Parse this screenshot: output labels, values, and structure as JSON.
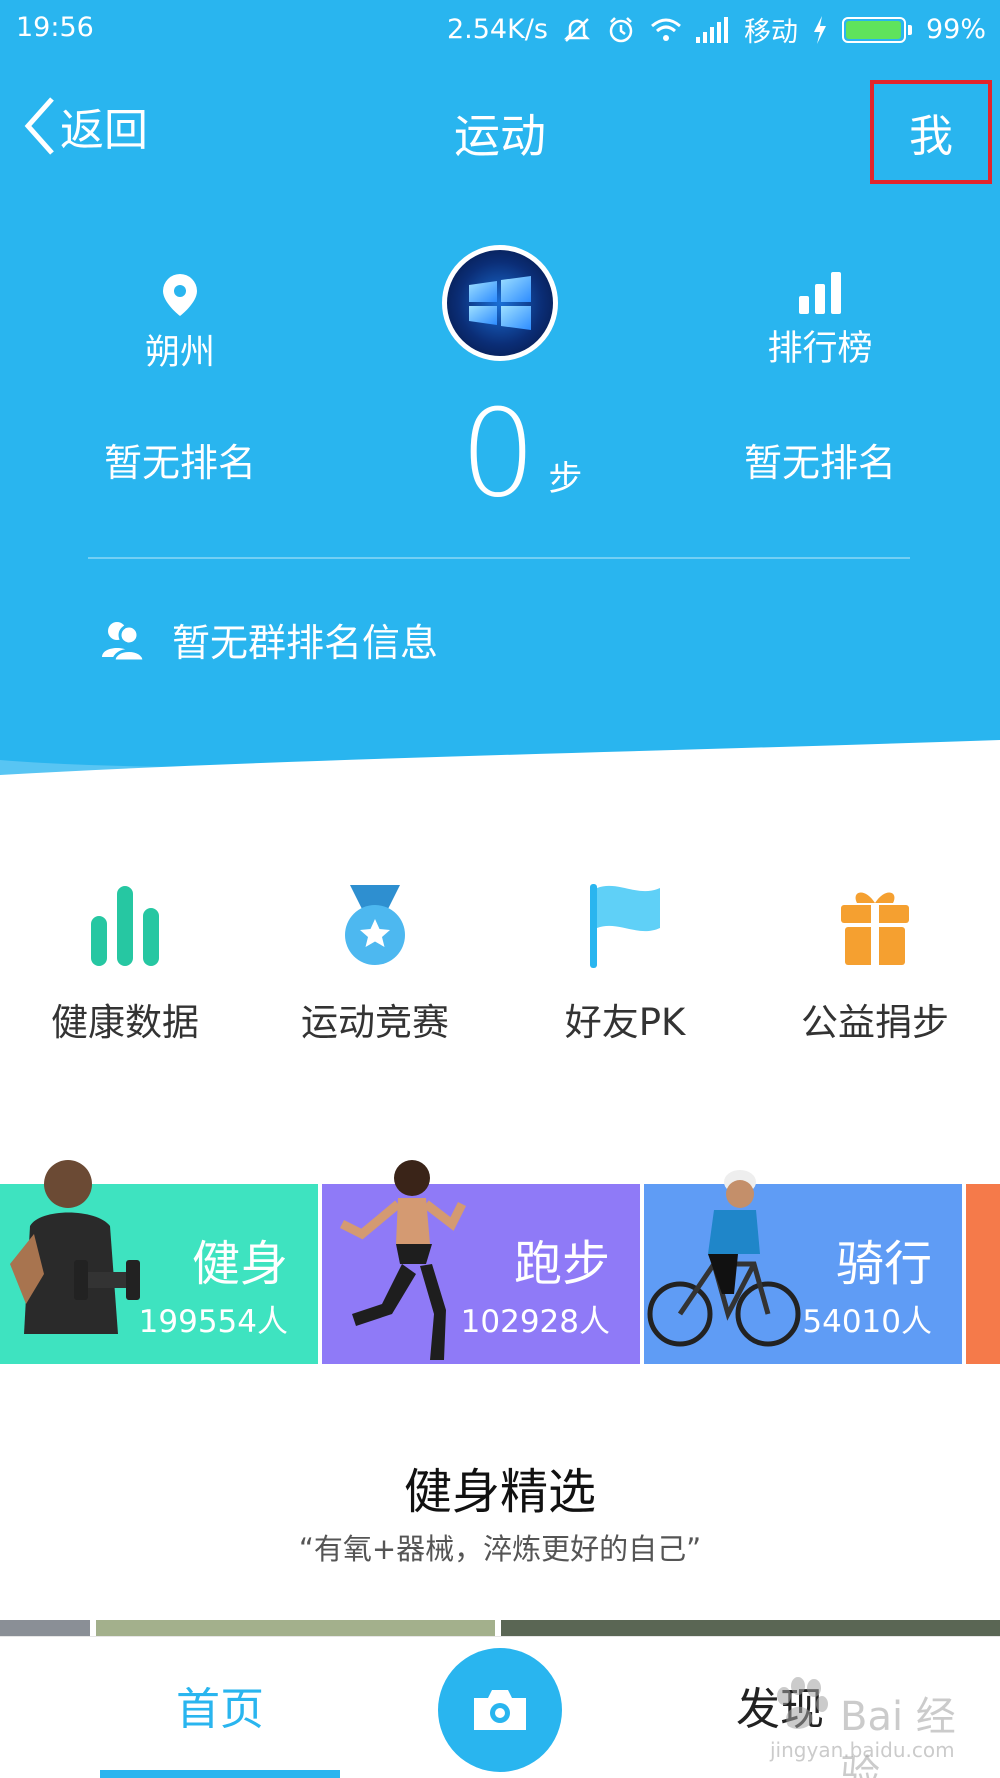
{
  "status_bar": {
    "time": "19:56",
    "net_speed": "2.54K/s",
    "carrier": "移动",
    "battery": "99%",
    "battery_level": 0.99,
    "icons": [
      "mute-icon",
      "alarm-icon",
      "wifi-icon",
      "signal-icon",
      "charging-icon"
    ]
  },
  "nav": {
    "back_label": "返回",
    "title": "运动",
    "me_label": "我"
  },
  "summary": {
    "city": "朔州",
    "leaderboard_label": "排行榜",
    "city_rank": "暂无排名",
    "steps": "0",
    "steps_unit": "步",
    "friend_rank": "暂无排名",
    "group_rank": "暂无群排名信息"
  },
  "functions": [
    {
      "label": "健康数据",
      "icon": "bar-chart-icon",
      "color": "#26c7a2"
    },
    {
      "label": "运动竞赛",
      "icon": "medal-icon",
      "color": "#4db8f0"
    },
    {
      "label": "好友PK",
      "icon": "flag-icon",
      "color": "#4fc9f5"
    },
    {
      "label": "公益捐步",
      "icon": "gift-icon",
      "color": "#f5a030"
    }
  ],
  "sport_cards": [
    {
      "title": "健身",
      "count": "199554人",
      "color": "#3ee3c0"
    },
    {
      "title": "跑步",
      "count": "102928人",
      "color": "#8f7af7"
    },
    {
      "title": "骑行",
      "count": "54010人",
      "color": "#5f9cf5"
    }
  ],
  "featured": {
    "title": "健身精选",
    "subtitle": "“有氧+器械，淬炼更好的自己”"
  },
  "tabbar": {
    "home_label": "首页",
    "discover_label": "发现"
  },
  "watermark": {
    "line1": "Bai 经验",
    "line2": "jingyan.baidu.com"
  },
  "colors": {
    "primary": "#29b5ef",
    "highlight_box": "#e3242b"
  }
}
